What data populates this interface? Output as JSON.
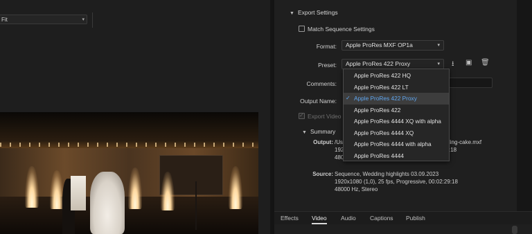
{
  "preview": {
    "fit_select": "Fit"
  },
  "export_settings": {
    "section_title": "Export Settings",
    "match_sequence_label": "Match Sequence Settings",
    "format_label": "Format:",
    "format_value": "Apple ProRes MXF OP1a",
    "preset_label": "Preset:",
    "preset_value": "Apple ProRes 422 Proxy",
    "comments_label": "Comments:",
    "output_name_label": "Output Name:",
    "export_video_label": "Export Video"
  },
  "preset_menu": {
    "items": [
      "Apple ProRes 422 HQ",
      "Apple ProRes 422 LT",
      "Apple ProRes 422 Proxy",
      "Apple ProRes 422",
      "Apple ProRes 4444 XQ with alpha",
      "Apple ProRes 4444 XQ",
      "Apple ProRes 4444 with alpha",
      "Apple ProRes 4444"
    ],
    "selected_index": 2
  },
  "summary": {
    "title": "Summary",
    "output_label": "Output:",
    "output_lines": [
      "/Us",
      "1920",
      "480"
    ],
    "output_right_lines": [
      "ling-cake.mxf",
      ":18"
    ],
    "source_label": "Source:",
    "source_lines": [
      "Sequence, Wedding highlights 03.09.2023",
      "1920x1080 (1,0), 25 fps, Progressive, 00:02:29:18",
      "48000 Hz, Stereo"
    ]
  },
  "tabs": [
    "Effects",
    "Video",
    "Audio",
    "Captions",
    "Publish"
  ],
  "active_tab": "Video",
  "colors": {
    "accent_selected": "#5fa6f0",
    "panel_bg": "#1f1f1f"
  },
  "icons": [
    "chevron-down-icon",
    "save-preset-icon",
    "import-preset-icon",
    "trash-icon",
    "checkmark-icon",
    "caret-down-icon"
  ]
}
